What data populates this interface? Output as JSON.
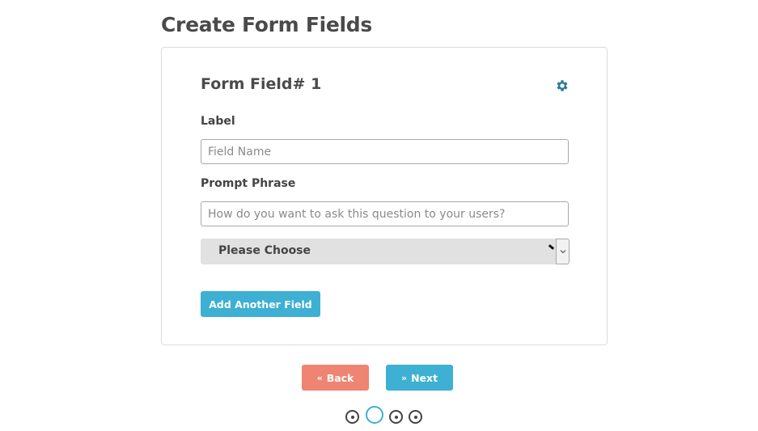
{
  "page": {
    "title": "Create Form Fields"
  },
  "form_field": {
    "title": "Form Field# 1",
    "settings_icon": "gear-icon",
    "label_heading": "Label",
    "label_input": {
      "value": "",
      "placeholder": "Field Name"
    },
    "prompt_heading": "Prompt Phrase",
    "prompt_input": {
      "value": "",
      "placeholder": "How do you want to ask this question to your users?"
    },
    "type_select": {
      "selected": "Please Choose"
    },
    "add_button_label": "Add Another Field"
  },
  "navigation": {
    "back_label": "Back",
    "back_icon": "double-chevron-left-icon",
    "next_label": "Next",
    "next_icon": "double-chevron-right-icon"
  },
  "steps": {
    "total": 4,
    "current": 2
  },
  "colors": {
    "accent": "#3db0d3",
    "back_button": "#ee8471",
    "gear": "#2a7d95",
    "text": "#444444"
  }
}
